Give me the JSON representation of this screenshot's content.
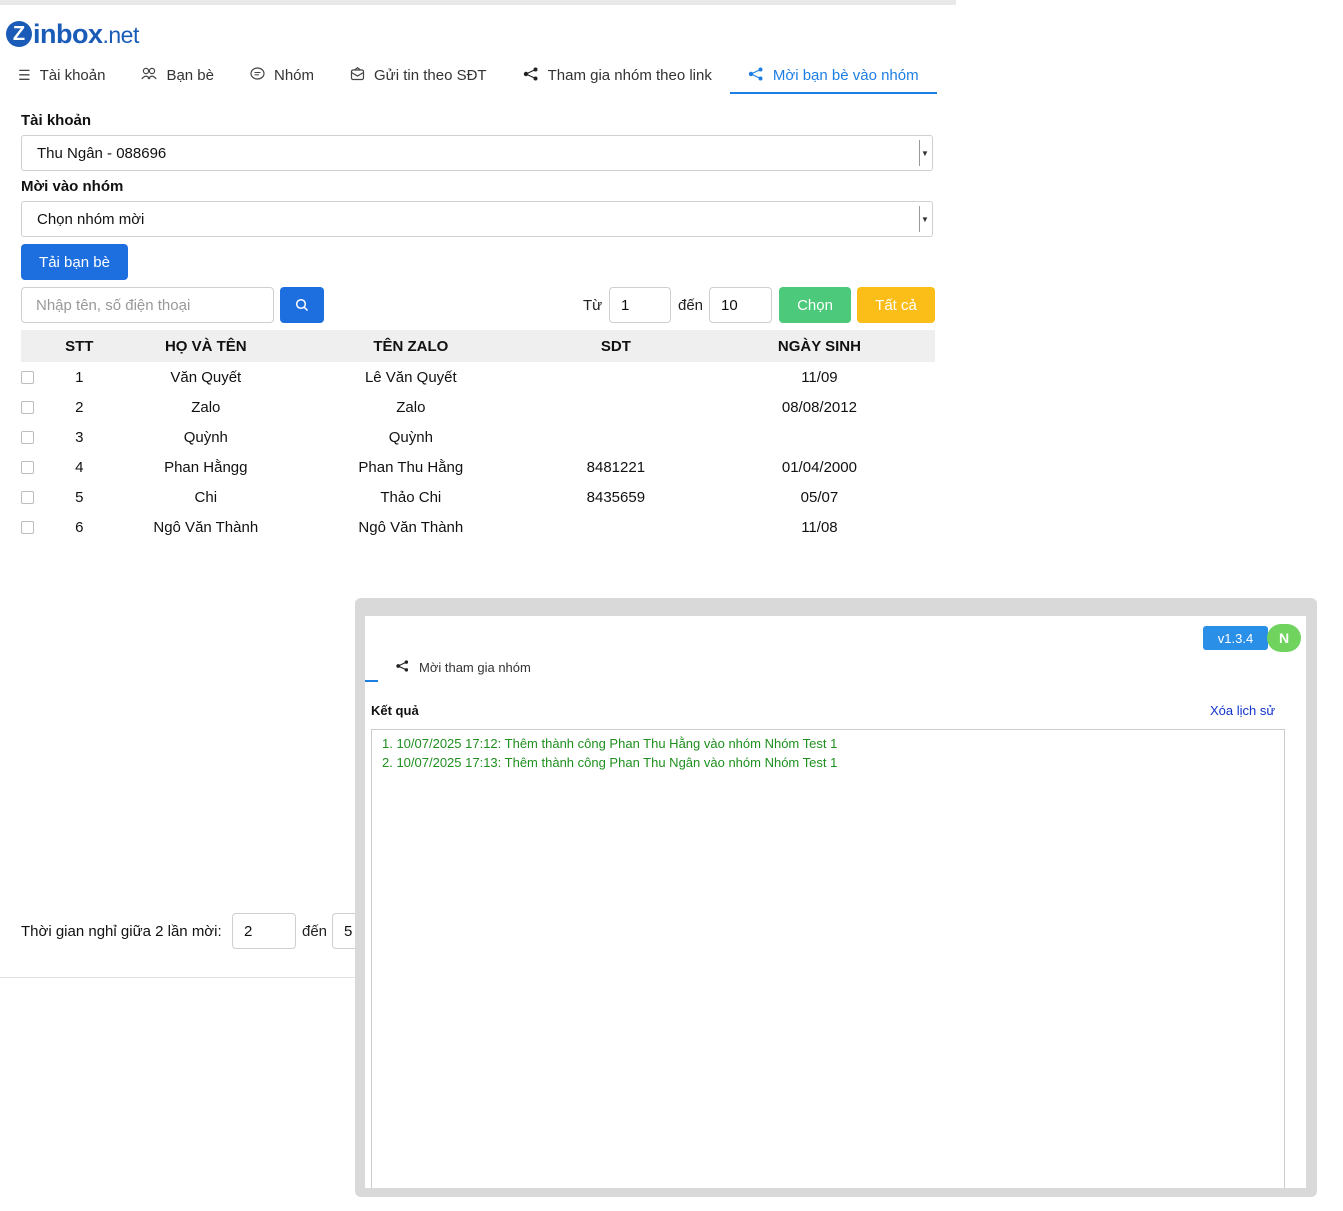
{
  "app": {
    "logo_letter": "Z",
    "logo_main": "inbox",
    "logo_suffix": ".net"
  },
  "tabs": [
    {
      "label": "Tài khoản",
      "icon": "menu-icon"
    },
    {
      "label": "Bạn bè",
      "icon": "users-icon"
    },
    {
      "label": "Nhóm",
      "icon": "chat-icon"
    },
    {
      "label": "Gửi tin theo SĐT",
      "icon": "message-box-icon"
    },
    {
      "label": "Tham gia nhóm theo link",
      "icon": "share-icon"
    },
    {
      "label": "Mời bạn bè vào nhóm",
      "icon": "share-icon",
      "active": true
    }
  ],
  "form": {
    "account_label": "Tài khoản",
    "account_value": "Thu Ngân - 088696",
    "group_label": "Mời vào nhóm",
    "group_value": "Chọn nhóm mời",
    "load_friends_button": "Tải bạn bè",
    "search_placeholder": "Nhập tên, số điện thoại",
    "from_label": "Từ",
    "from_value": "1",
    "to_label": "đến",
    "to_value": "10",
    "select_button": "Chọn",
    "all_button": "Tất cả"
  },
  "table": {
    "headers": [
      "STT",
      "HỌ VÀ TÊN",
      "TÊN ZALO",
      "SDT",
      "NGÀY SINH"
    ],
    "rows": [
      {
        "stt": "1",
        "name": "Văn Quyết",
        "zalo": "Lê Văn Quyết",
        "sdt": "",
        "dob": "11/09"
      },
      {
        "stt": "2",
        "name": "Zalo",
        "zalo": "Zalo",
        "sdt": "",
        "dob": "08/08/2012"
      },
      {
        "stt": "3",
        "name": "Quỳnh",
        "zalo": "Quỳnh",
        "sdt": "",
        "dob": ""
      },
      {
        "stt": "4",
        "name": "Phan Hằngg",
        "zalo": "Phan Thu Hằng",
        "sdt": "8481221",
        "dob": "01/04/2000"
      },
      {
        "stt": "5",
        "name": "Chi",
        "zalo": "Thảo Chi",
        "sdt": "8435659",
        "dob": "05/07"
      },
      {
        "stt": "6",
        "name": "Ngô Văn Thành",
        "zalo": "Ngô Văn Thành",
        "sdt": "",
        "dob": "11/08"
      }
    ]
  },
  "rest": {
    "label": "Thời gian nghỉ giữa 2 lần mời:",
    "from_value": "2",
    "to_label": "đến",
    "to_value": "5"
  },
  "panel": {
    "version": "v1.3.4",
    "avatar": "N",
    "tab_label": "Mời tham gia nhóm",
    "result_label": "Kết quả",
    "clear_history": "Xóa lịch sử",
    "logs": [
      "1. 10/07/2025 17:12: Thêm thành công Phan Thu Hằng vào nhóm Nhóm Test 1",
      "2. 10/07/2025 17:13: Thêm thành công Phan Thu Ngân vào nhóm Nhóm Test 1"
    ],
    "log_color": "#1e8f1e"
  },
  "colors": {
    "primary": "#1d6fe0",
    "green": "#4cc97a",
    "yellow": "#fbbd17",
    "tab_active": "#1d7fe3"
  }
}
